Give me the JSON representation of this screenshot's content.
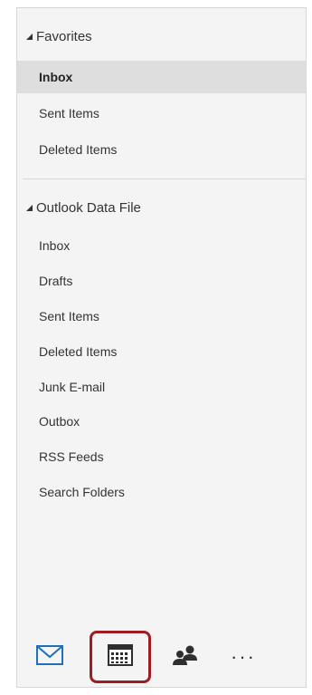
{
  "favorites": {
    "header": "Favorites",
    "items": [
      {
        "label": "Inbox",
        "selected": true
      },
      {
        "label": "Sent Items",
        "selected": false
      },
      {
        "label": "Deleted Items",
        "selected": false
      }
    ]
  },
  "data_file": {
    "header": "Outlook Data File",
    "items": [
      {
        "label": "Inbox"
      },
      {
        "label": "Drafts"
      },
      {
        "label": "Sent Items"
      },
      {
        "label": "Deleted Items"
      },
      {
        "label": "Junk E-mail"
      },
      {
        "label": "Outbox"
      },
      {
        "label": "RSS Feeds"
      },
      {
        "label": "Search Folders"
      }
    ]
  },
  "nav": {
    "buttons": [
      {
        "icon": "mail-icon",
        "active": true
      },
      {
        "icon": "calendar-icon",
        "highlighted": true
      },
      {
        "icon": "people-icon"
      },
      {
        "icon": "more-icon",
        "text": "···"
      }
    ]
  },
  "colors": {
    "mail_blue": "#1e6fc0",
    "highlight_red": "#a01c24",
    "selected_bg": "#dedede"
  }
}
